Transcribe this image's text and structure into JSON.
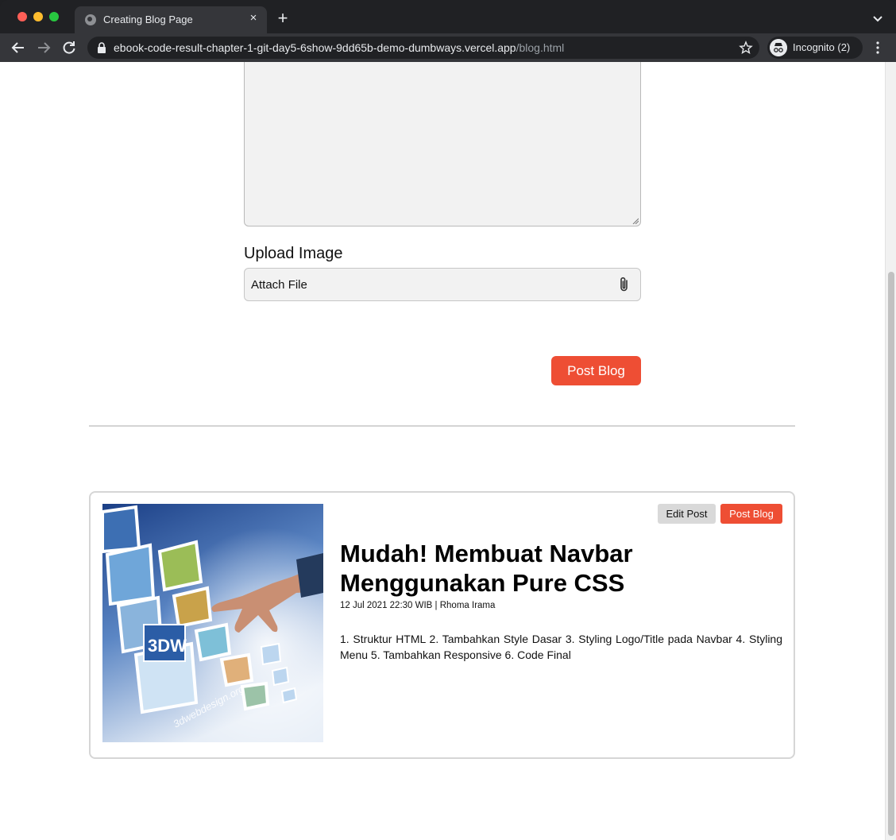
{
  "browser": {
    "tab_title": "Creating Blog Page",
    "tab_close": "×",
    "new_tab": "+",
    "url_host": "ebook-code-result-chapter-1-git-day5-6show-9dd65b-demo-dumbways.vercel.app",
    "url_path": "/blog.html",
    "profile_label": "Incognito (2)"
  },
  "form": {
    "upload_label": "Upload Image",
    "attach_text": "Attach File",
    "post_button": "Post Blog"
  },
  "blog_card": {
    "edit_button": "Edit Post",
    "post_button": "Post Blog",
    "title": "Mudah! Membuat Navbar Menggunakan Pure CSS",
    "meta": "12 Jul 2021 22:30 WIB | Rhoma Irama",
    "body": "1. Struktur HTML 2. Tambahkan Style Dasar 3. Styling Logo/Title pada Navbar 4. Styling Menu 5. Tambahkan Responsive 6. Code Final",
    "image_watermark": "3dwebdesign.org",
    "image_logo": "3DW"
  },
  "colors": {
    "accent": "#ee4e34",
    "chrome_dark": "#202124",
    "chrome_toolbar": "#35363a"
  }
}
